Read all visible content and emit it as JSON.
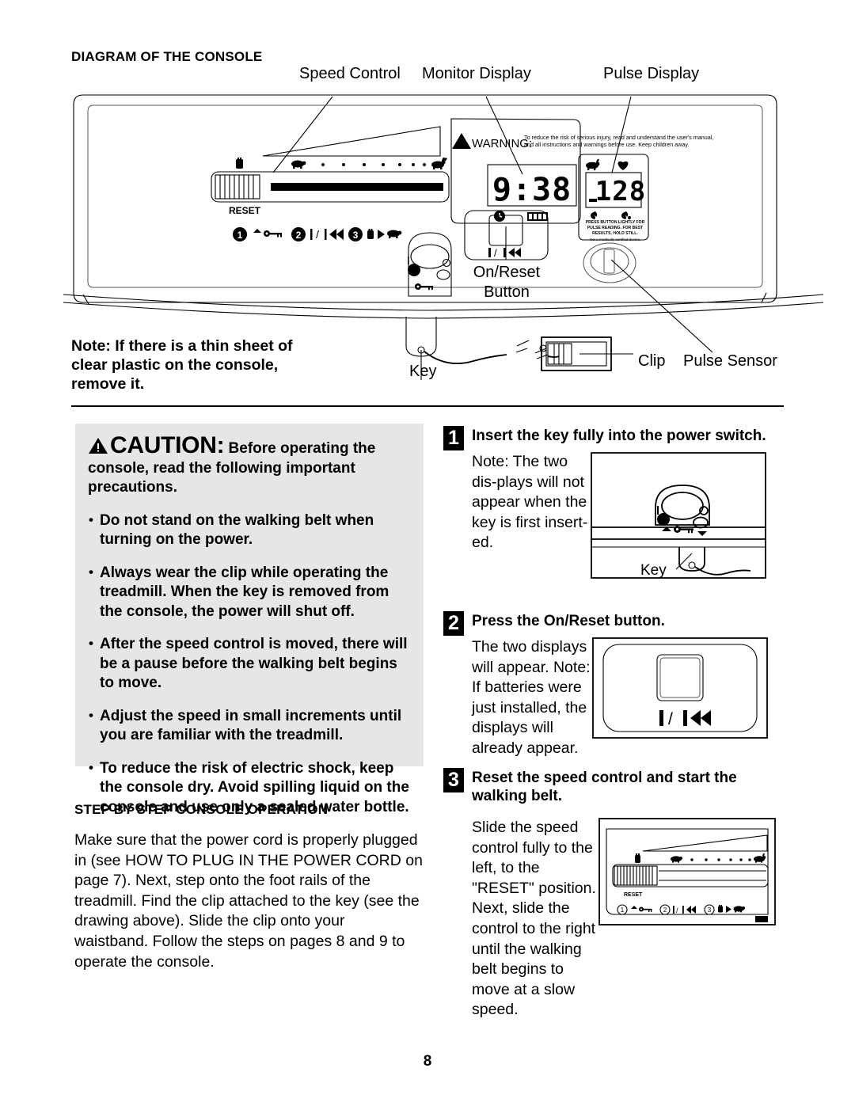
{
  "page": {
    "number": "8"
  },
  "diagram": {
    "heading": "DIAGRAM OF THE CONSOLE",
    "labels": {
      "speed_control": "Speed Control",
      "monitor_display": "Monitor Display",
      "pulse_display": "Pulse Display",
      "on_reset_button_line1": "On/Reset",
      "on_reset_button_line2": "Button",
      "key": "Key",
      "clip": "Clip",
      "pulse_sensor": "Pulse Sensor"
    },
    "console": {
      "warning_title": "WARNING:",
      "warning_text_line1": "To reduce the risk of serious injury, read and understand the user's manual,",
      "warning_text_line2": "and all instructions and warnings before use.  Keep children away.",
      "monitor_value": "9:38",
      "pulse_value": "128",
      "reset_label": "RESET",
      "step_icons": [
        "1",
        "2",
        "3"
      ],
      "pulse_note_line1": "PRESS BUTTON LIGHTLY FOR",
      "pulse_note_line2": "PULSE READING.  FOR BEST",
      "pulse_note_line3": "RESULTS, HOLD STILL.",
      "pulse_note_line4": "Not a medically certified device.",
      "on_reset_symbol": "| / |◀◀"
    },
    "note": "Note: If there is a thin sheet of clear plastic on the console, remove it."
  },
  "caution": {
    "icon": "warning-triangle-icon",
    "title_word": "CAUTION",
    "title_colon": ":",
    "title_rest": "Before operating the console, read the following important precautions.",
    "items": [
      "Do not stand on the walking belt when turning on the power.",
      "Always wear the clip while operating the treadmill. When the key is removed from the console, the power will shut off.",
      "After the speed control is moved, there will be a pause before the walking belt begins to move.",
      "Adjust the speed in small increments until you are familiar with the treadmill.",
      "To reduce the risk of electric shock, keep the console dry. Avoid spilling liquid on the console and use only a sealed water bottle."
    ]
  },
  "step_section": {
    "heading": "STEP BY STEP CONSOLE OPERATION",
    "body": "Make sure that the power cord is properly plugged in (see HOW TO PLUG IN THE POWER CORD on page 7). Next, step onto the foot rails of the treadmill. Find the clip attached to the key (see the drawing above). Slide the clip onto your waistband. Follow the steps on pages 8 and 9 to operate the console."
  },
  "steps": [
    {
      "number": "1",
      "title": "Insert the key fully into the power switch.",
      "text": "Note: The two dis-plays will not appear when the key is first insert-ed.",
      "figure_label": "Key"
    },
    {
      "number": "2",
      "title": "Press the On/Reset button.",
      "text": "The two displays will appear. Note: If batteries were just installed, the displays will already appear.",
      "figure_symbol": "| / |◀◀"
    },
    {
      "number": "3",
      "title": "Reset the speed control and start the walking belt.",
      "text": "Slide the speed control fully to the left, to the \"RESET\" position. Next, slide the control to the right until the walking belt begins to move at a slow speed.",
      "figure_reset_label": "RESET",
      "figure_step_icons": [
        "1",
        "2",
        "3"
      ]
    }
  ],
  "colors": {
    "caution_box_bg": "#e6e6e6",
    "ink": "#000000",
    "paper": "#ffffff"
  }
}
